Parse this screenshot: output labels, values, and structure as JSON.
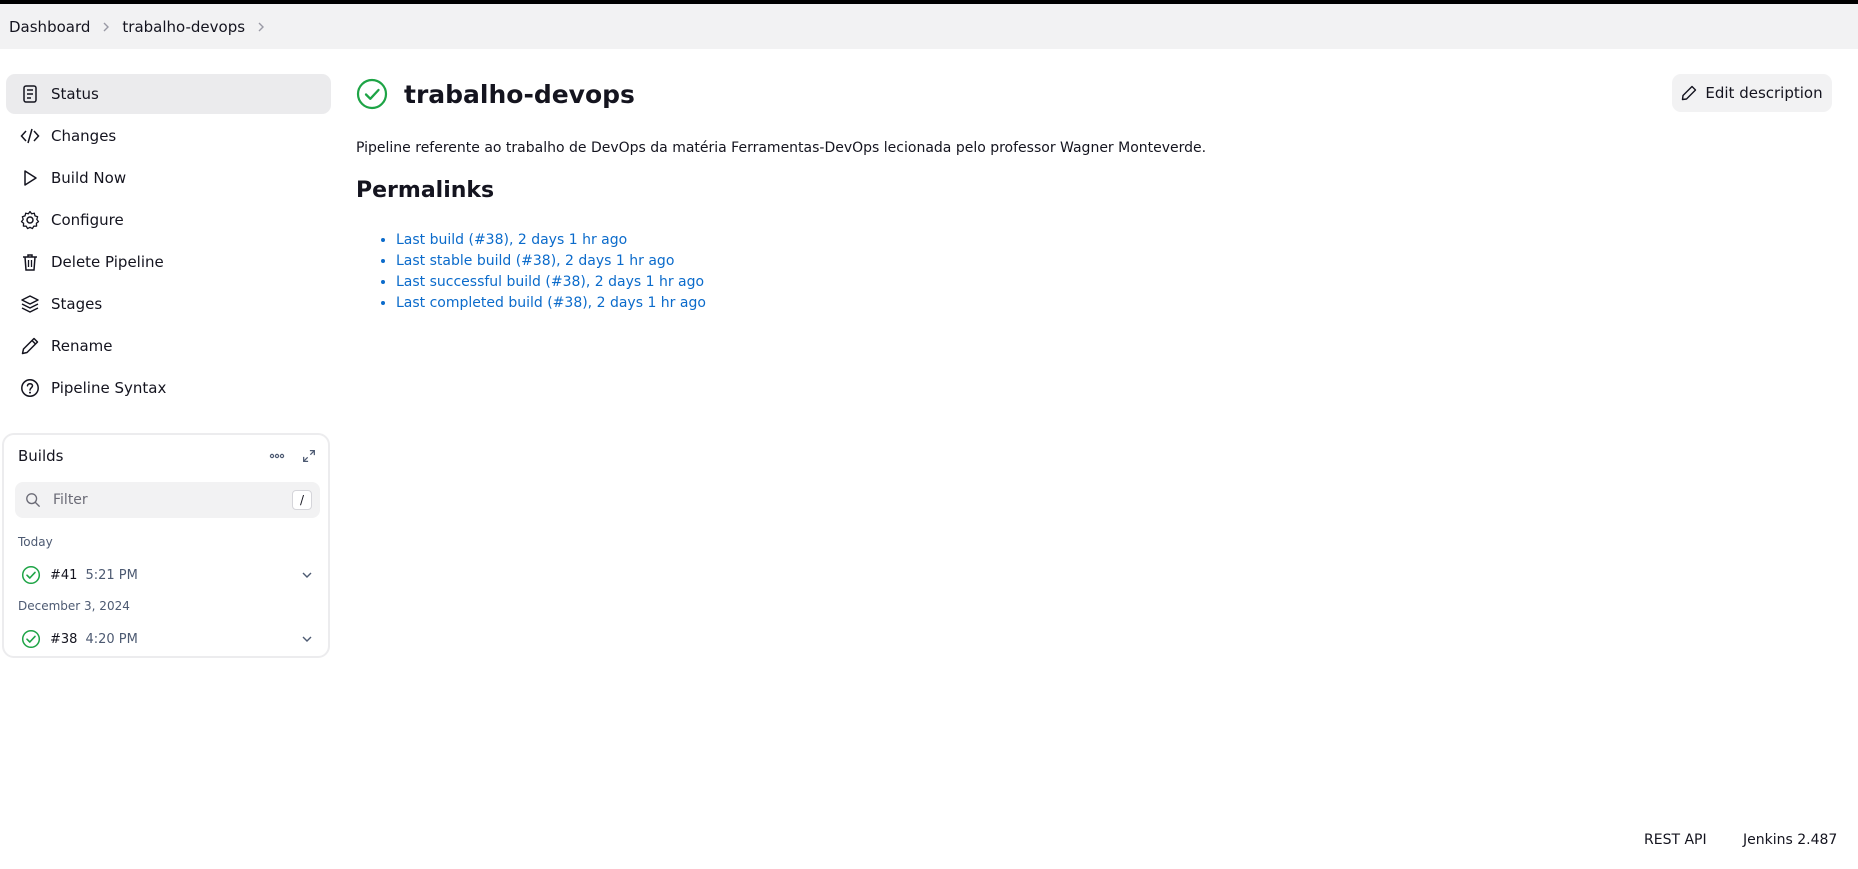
{
  "breadcrumb": {
    "items": [
      "Dashboard",
      "trabalho-devops"
    ]
  },
  "sidebar": {
    "items": [
      {
        "label": "Status",
        "icon": "status-icon"
      },
      {
        "label": "Changes",
        "icon": "code-icon"
      },
      {
        "label": "Build Now",
        "icon": "play-icon"
      },
      {
        "label": "Configure",
        "icon": "gear-icon"
      },
      {
        "label": "Delete Pipeline",
        "icon": "trash-icon"
      },
      {
        "label": "Stages",
        "icon": "layers-icon"
      },
      {
        "label": "Rename",
        "icon": "pencil-icon"
      },
      {
        "label": "Pipeline Syntax",
        "icon": "help-icon"
      }
    ]
  },
  "builds": {
    "title": "Builds",
    "filter_placeholder": "Filter",
    "filter_shortcut": "/",
    "groups": [
      {
        "date": "Today",
        "builds": [
          {
            "number": "#41",
            "time": "5:21 PM"
          }
        ]
      },
      {
        "date": "December 3, 2024",
        "builds": [
          {
            "number": "#38",
            "time": "4:20 PM"
          }
        ]
      }
    ]
  },
  "main": {
    "title": "trabalho-devops",
    "edit_description_label": "Edit description",
    "description": "Pipeline referente ao trabalho de DevOps da matéria Ferramentas-DevOps lecionada pelo professor Wagner Monteverde.",
    "permalinks_title": "Permalinks",
    "permalinks": [
      "Last build (#38), 2 days 1 hr ago",
      "Last stable build (#38), 2 days 1 hr ago",
      "Last successful build (#38), 2 days 1 hr ago",
      "Last completed build (#38), 2 days 1 hr ago"
    ]
  },
  "footer": {
    "rest_api": "REST API",
    "version": "Jenkins 2.487"
  },
  "colors": {
    "success": "#1ea446",
    "link": "#0b6bcb",
    "active_bg": "#ebebed"
  }
}
